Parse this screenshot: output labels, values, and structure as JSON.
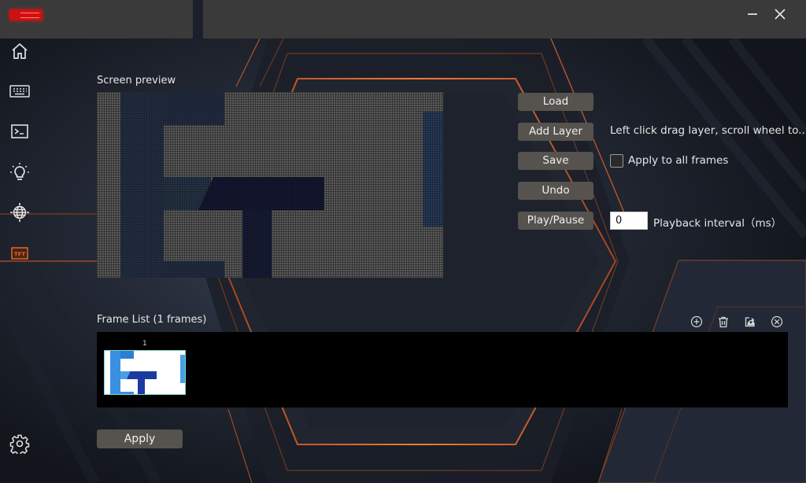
{
  "window": {
    "logo": "brand-logo",
    "minimize_icon": "minimize-icon",
    "close_icon": "close-icon"
  },
  "sidebar": {
    "items": [
      {
        "icon": "home-icon",
        "active": false
      },
      {
        "icon": "keyboard-icon",
        "active": false
      },
      {
        "icon": "terminal-icon",
        "active": false
      },
      {
        "icon": "lightbulb-icon",
        "active": false
      },
      {
        "icon": "globe-icon",
        "active": false
      },
      {
        "icon": "tft-icon",
        "label": "TFT",
        "active": true
      }
    ],
    "settings_icon": "gear-icon"
  },
  "preview": {
    "title": "Screen preview"
  },
  "controls": {
    "load_label": "Load",
    "add_layer_label": "Add Layer",
    "save_label": "Save",
    "undo_label": "Undo",
    "play_pause_label": "Play/Pause",
    "hint_text": "Left click drag layer, scroll wheel to...",
    "apply_all_label": "Apply to all frames",
    "apply_all_checked": false,
    "interval_value": "0",
    "interval_label": "Playback interval（ms）"
  },
  "frames": {
    "title": "Frame List  (1 frames)",
    "tools": [
      {
        "icon": "add-circle-icon"
      },
      {
        "icon": "trash-icon"
      },
      {
        "icon": "export-icon"
      },
      {
        "icon": "close-circle-icon"
      }
    ],
    "items": [
      {
        "number": "1"
      }
    ]
  },
  "footer": {
    "apply_label": "Apply"
  },
  "colors": {
    "accent_orange": "#e0662a",
    "button_bg": "#56534e",
    "titlebar_bg": "#3a3a3a"
  }
}
